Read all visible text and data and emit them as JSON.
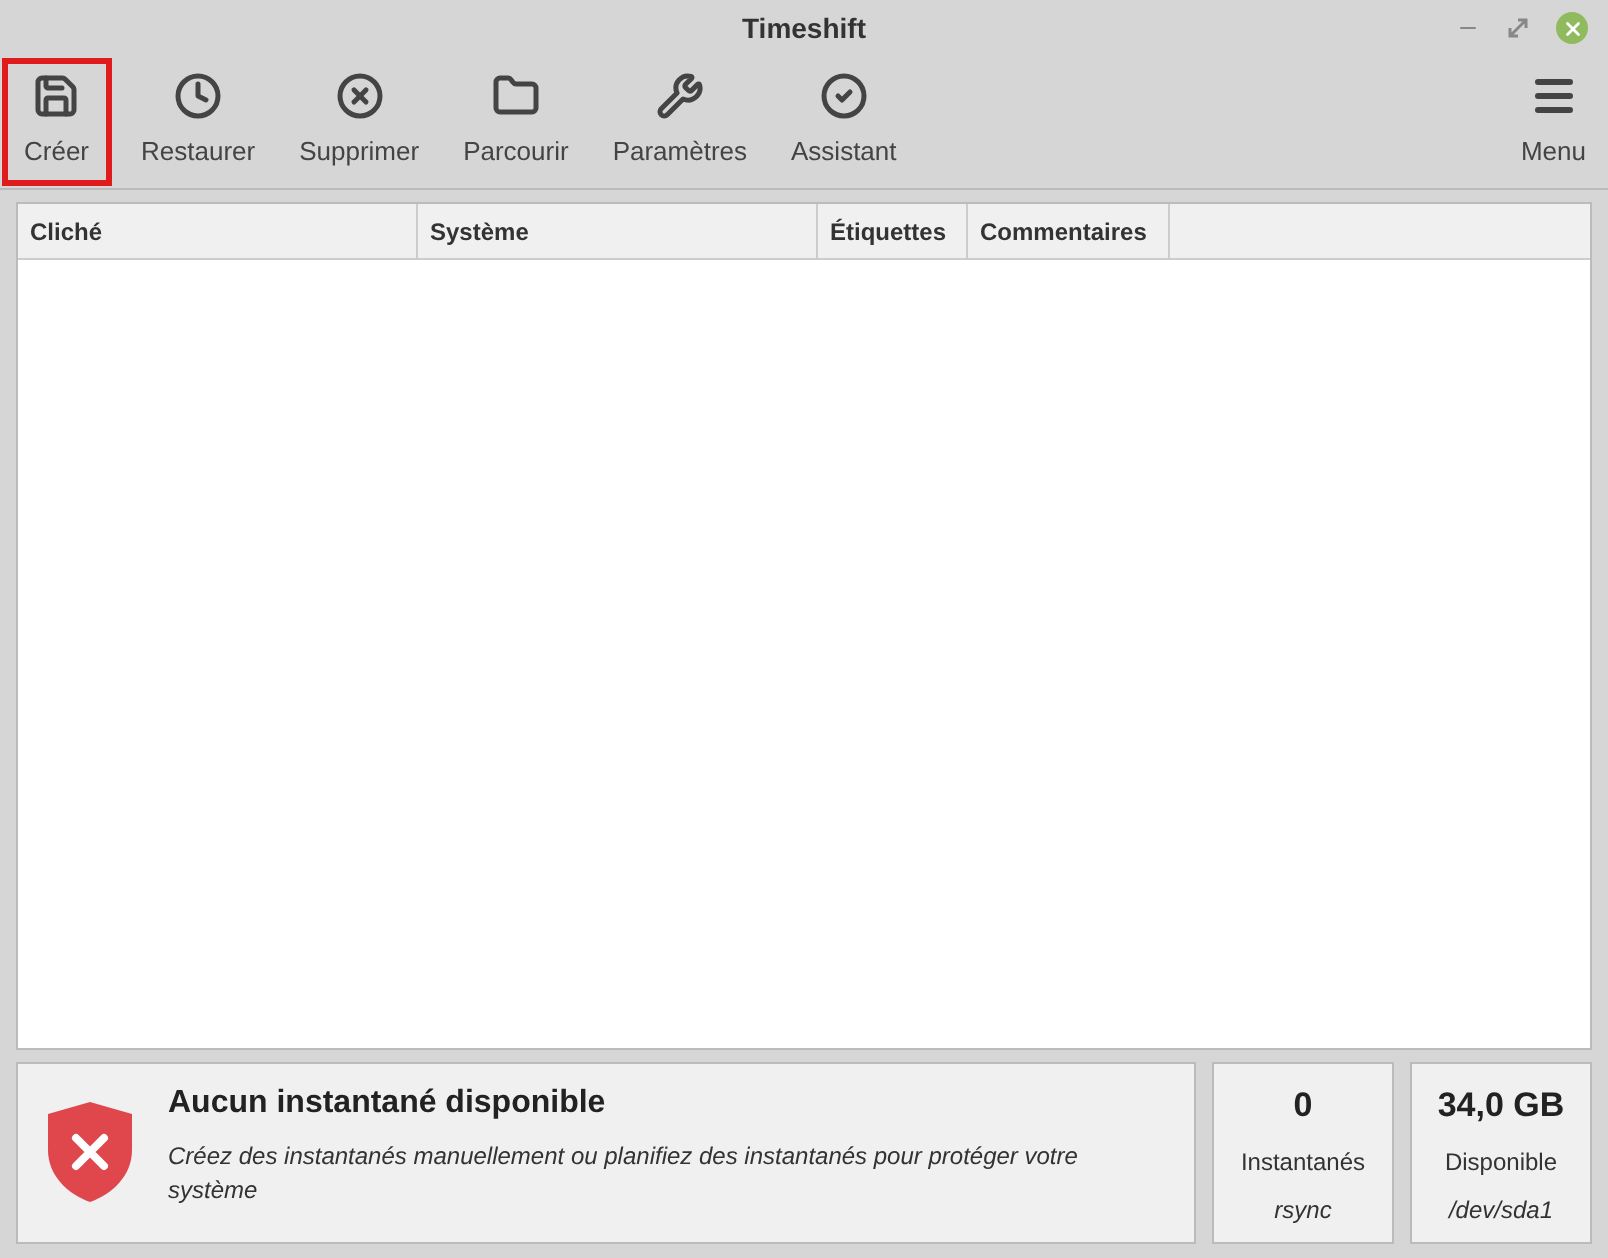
{
  "window": {
    "title": "Timeshift"
  },
  "toolbar": [
    {
      "kind": "create",
      "label": "Créer",
      "highlighted": true
    },
    {
      "kind": "restore",
      "label": "Restaurer",
      "highlighted": false
    },
    {
      "kind": "delete",
      "label": "Supprimer",
      "highlighted": false
    },
    {
      "kind": "browse",
      "label": "Parcourir",
      "highlighted": false
    },
    {
      "kind": "settings",
      "label": "Paramètres",
      "highlighted": false
    },
    {
      "kind": "wizard",
      "label": "Assistant",
      "highlighted": false
    }
  ],
  "menu": {
    "label": "Menu"
  },
  "table": {
    "columns": [
      "Cliché",
      "Système",
      "Étiquettes",
      "Commentaires"
    ]
  },
  "status": {
    "title": "Aucun instantané disponible",
    "message": "Créez des instantanés manuellement ou planifiez des instantanés pour protéger votre système"
  },
  "stats": [
    {
      "value": "0",
      "label": "Instantanés",
      "sub": "rsync"
    },
    {
      "value": "34,0 GB",
      "label": "Disponible",
      "sub": "/dev/sda1"
    }
  ]
}
